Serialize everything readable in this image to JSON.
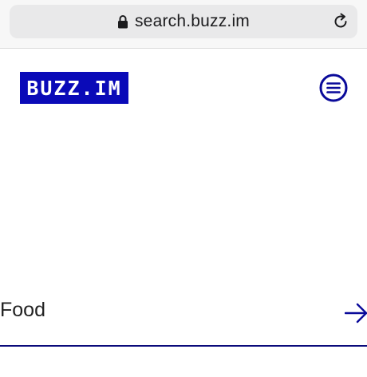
{
  "browser": {
    "url": "search.buzz.im",
    "icons": {
      "lock": "lock-icon",
      "reload": "reload-icon"
    }
  },
  "header": {
    "logo_text": "BUZZ.IM",
    "brand_color": "#0a0ab8",
    "menu_icon": "hamburger-menu-icon"
  },
  "categories": [
    {
      "label": "Food",
      "icon": "arrow-right-icon"
    }
  ]
}
